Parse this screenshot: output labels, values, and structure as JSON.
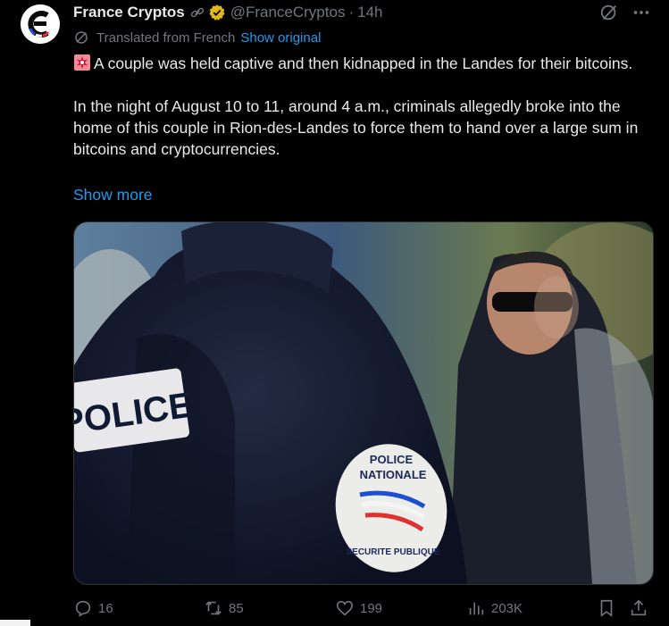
{
  "author": {
    "name": "France Cryptos",
    "handle": "@FranceCryptos",
    "separator": "·",
    "time": "14h",
    "avatar_icon": "france-cryptos-logo",
    "verified_badge_color": "#e2b719"
  },
  "translation": {
    "label": "Translated from French",
    "action": "Show original"
  },
  "post": {
    "paragraph1": "A couple was held captive and then kidnapped in the Landes for their bitcoins.",
    "paragraph2": "In the night of August 10 to 11, around 4 a.m., criminals allegedly broke into the home of this couple in Rion-des-Landes to force them to hand over a large sum in bitcoins and cryptocurrencies.",
    "show_more": "Show more",
    "emoji": "police-siren"
  },
  "media": {
    "patch_line1": "POLICE",
    "patch_line2": "NATIONALE",
    "patch_bottom": "SECURITE PUBLIQUE",
    "vest_text": "POLICE"
  },
  "actions": {
    "replies": "16",
    "reposts": "85",
    "likes": "199",
    "views": "203K"
  },
  "colors": {
    "accent": "#1d9bf0",
    "muted": "#71767b",
    "text": "#e7e9ea",
    "background": "#000000"
  }
}
